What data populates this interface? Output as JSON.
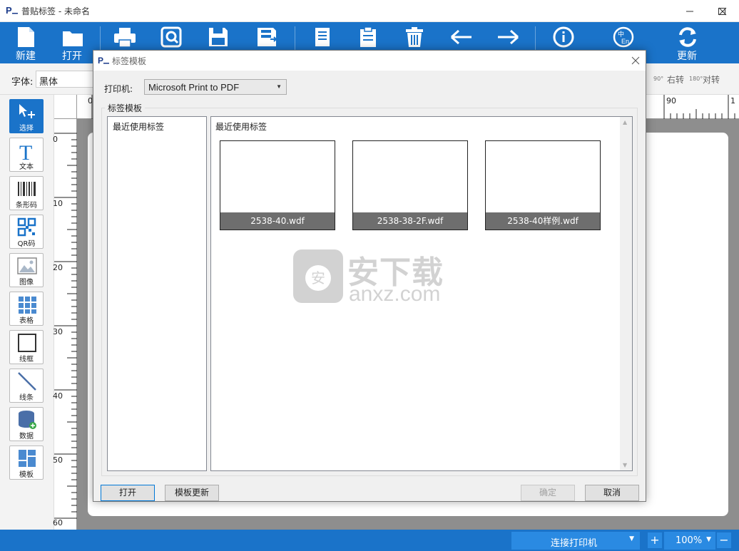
{
  "app": {
    "title": "普贴标签 - 未命名"
  },
  "toolbar": {
    "new_label": "新建",
    "open_label": "打开",
    "update_label": "更新",
    "icons": [
      "print-icon",
      "preview-icon",
      "save-icon",
      "save-as-icon",
      "copy-icon",
      "paste-icon",
      "delete-icon",
      "undo-icon",
      "redo-icon",
      "info-icon",
      "language-icon"
    ]
  },
  "fontbar": {
    "font_label": "字体:",
    "font_value": "黑体",
    "rotate_right": "右转",
    "rotate_180": "对转",
    "rotate_right_icon_text": "90°",
    "rotate_180_icon_text": "180°"
  },
  "tools": [
    {
      "label": "选择",
      "icon": "select-icon",
      "active": true
    },
    {
      "label": "文本",
      "icon": "text-icon"
    },
    {
      "label": "条形码",
      "icon": "barcode-icon"
    },
    {
      "label": "QR码",
      "icon": "qrcode-icon"
    },
    {
      "label": "图像",
      "icon": "image-icon"
    },
    {
      "label": "表格",
      "icon": "table-icon"
    },
    {
      "label": "线框",
      "icon": "rectangle-icon"
    },
    {
      "label": "线条",
      "icon": "line-icon"
    },
    {
      "label": "数据",
      "icon": "database-icon"
    },
    {
      "label": "模板",
      "icon": "template-icon"
    }
  ],
  "rulers": {
    "vertical": [
      "0",
      "10",
      "20",
      "30",
      "40",
      "50",
      "60"
    ],
    "horizontal": [
      "0",
      "90",
      "1"
    ]
  },
  "statusbar": {
    "connect_printer": "连接打印机",
    "zoom_value": "100%",
    "zoom_in": "+",
    "zoom_out": "−"
  },
  "dialog": {
    "title": "标签模板",
    "printer_label": "打印机:",
    "printer_value": "Microsoft Print to PDF",
    "group_title": "标签模板",
    "left_list": [
      "最近使用标签"
    ],
    "pane_title": "最近使用标签",
    "templates": [
      "2538-40.wdf",
      "2538-38-2F.wdf",
      "2538-40样例.wdf"
    ],
    "buttons": {
      "open": "打开",
      "update": "模板更新",
      "ok": "确定",
      "cancel": "取消"
    }
  },
  "watermark": {
    "cn": "安下载",
    "en": "anxz.com",
    "badge": "安"
  },
  "colors": {
    "accent": "#1a73c9",
    "status_button": "#2a8ae2",
    "thumb_caption": "#6e6e6e"
  }
}
